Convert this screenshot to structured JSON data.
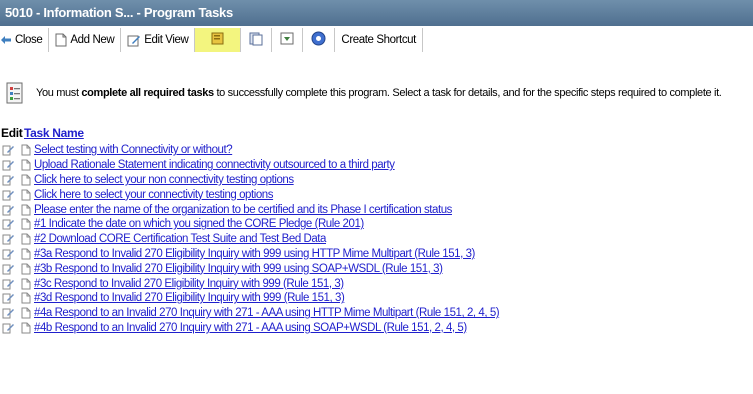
{
  "window": {
    "title": "5010 - Information S... - Program Tasks"
  },
  "toolbar": {
    "close_label": "Close",
    "add_new_label": "Add New",
    "edit_view_label": "Edit View",
    "create_shortcut_label": "Create Shortcut",
    "highlight_color": "#f3f57f"
  },
  "info": {
    "prefix": "You must ",
    "emphasis": "complete all required tasks",
    "suffix": " to successfully complete this program. Select a task for details, and for the specific steps required to complete it."
  },
  "list_header": {
    "edit_label": "Edit",
    "task_name_label": "Task Name"
  },
  "tasks": [
    "Select testing with Connectivity or without?",
    "Upload Rationale Statement indicating connectivity outsourced to a third party",
    "Click here to select your non connectivity testing options",
    "Click here to select your connectivity testing options",
    "Please enter the name of the organization to be certified and its Phase I certification status",
    "#1 Indicate the date on which you signed the CORE Pledge (Rule 201)",
    "#2 Download CORE Certification Test Suite and Test Bed Data",
    "#3a Respond to Invalid 270 Eligibility Inquiry with 999 using HTTP Mime Multipart (Rule 151, 3)",
    "#3b Respond to Invalid 270 Eligibility Inquiry with 999 using SOAP+WSDL (Rule 151, 3)",
    "#3c Respond to Invalid 270 Eligibility Inquiry with 999 (Rule 151, 3)",
    "#3d Respond to Invalid 270 Eligibility Inquiry with 999 (Rule 151, 3)",
    "#4a Respond to an Invalid 270 Inquiry with 271 - AAA using HTTP Mime Multipart (Rule 151, 2, 4, 5)",
    "#4b Respond to an Invalid 270 Inquiry with 271 - AAA using SOAP+WSDL (Rule 151, 2, 4, 5)"
  ],
  "colors": {
    "titlebar": "#5a7a98",
    "link": "#1f1fcc"
  }
}
